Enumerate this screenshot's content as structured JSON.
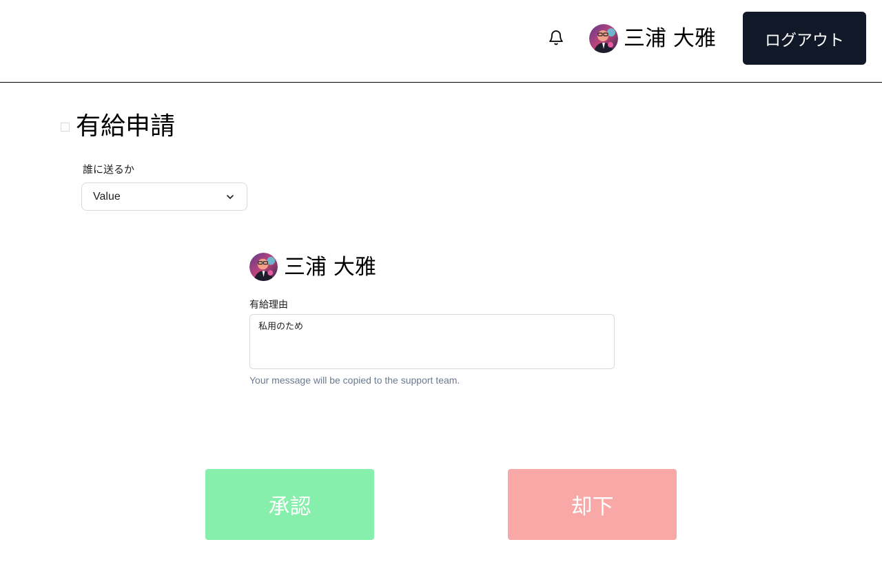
{
  "header": {
    "notification_icon": "bell-icon",
    "user_name": "三浦 大雅",
    "logout_label": "ログアウト",
    "logout_color": "#111827"
  },
  "page": {
    "title": "有給申請"
  },
  "send_to": {
    "label": "誰に送るか",
    "selected_value": "Value",
    "icon": "chevron-down-icon"
  },
  "applicant": {
    "name": "三浦 大雅",
    "reason_label": "有給理由",
    "reason_value": "私用のため",
    "helper_text": "Your message will be copied to the support team."
  },
  "actions": {
    "approve_label": "承認",
    "approve_color": "#86efac",
    "reject_label": "却下",
    "reject_color": "#f9a8a8"
  }
}
